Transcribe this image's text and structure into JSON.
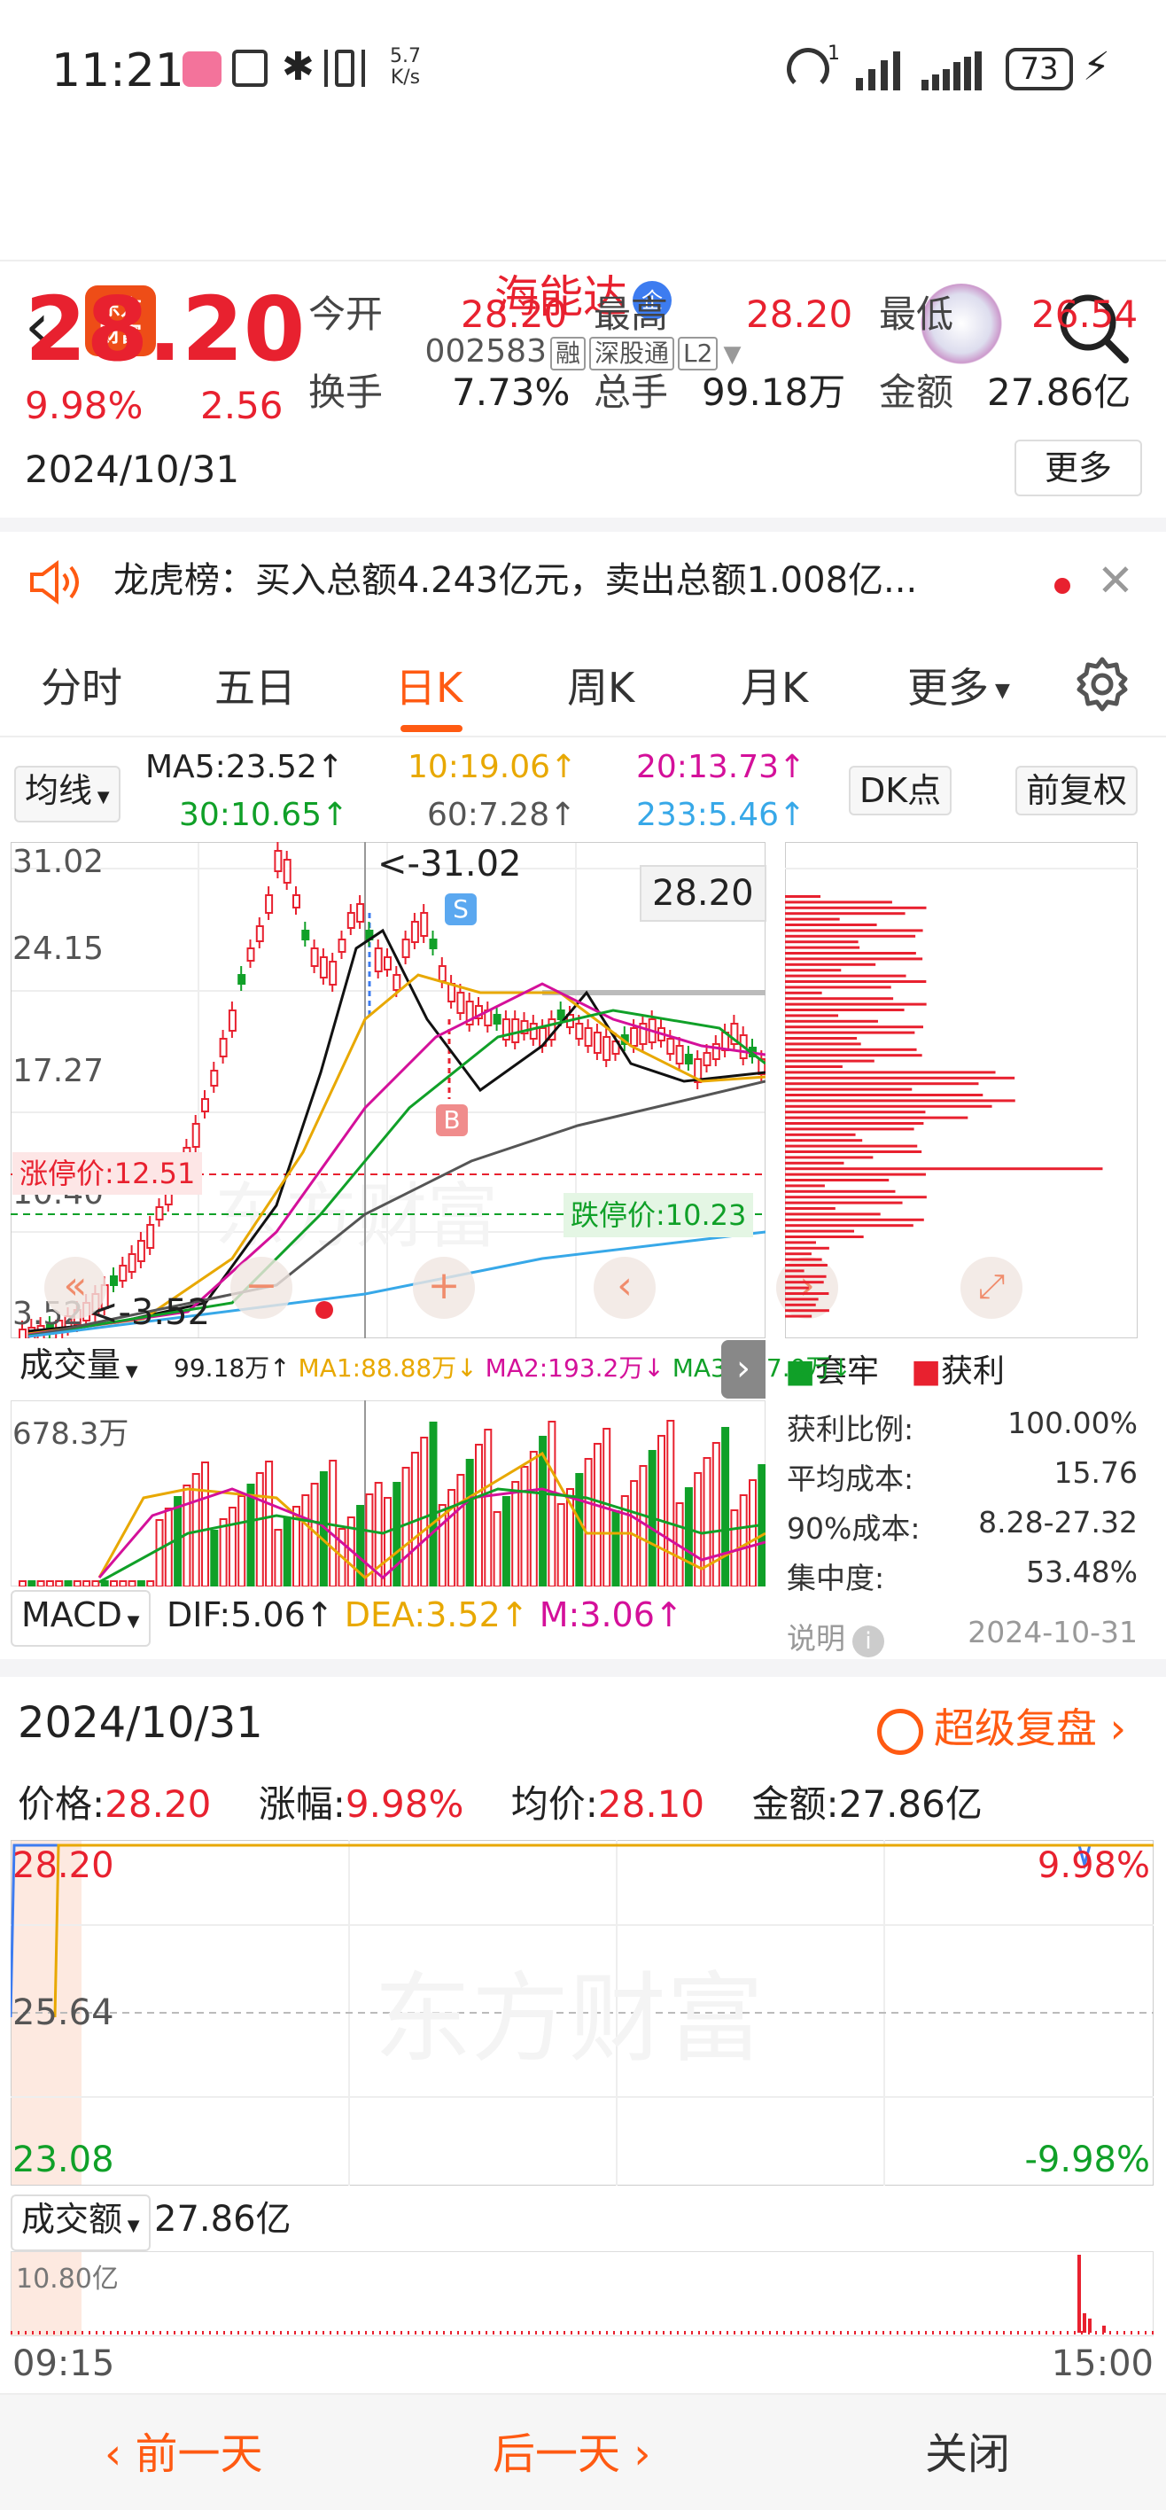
{
  "status_bar": {
    "time": "11:21",
    "speed_value": "5.7",
    "speed_unit": "K/s",
    "signal_sup": "1",
    "battery": "73"
  },
  "header": {
    "logo_text_1": "东方",
    "logo_text_2": "财富",
    "stock_name": "海能达",
    "badge": "企",
    "code": "002583",
    "tags": [
      "融",
      "深股通",
      "L2"
    ]
  },
  "quote": {
    "price": "28.20",
    "change_pct": "9.98%",
    "change": "2.56",
    "date": "2024/10/31",
    "stats": [
      {
        "label": "今开",
        "value": "28.20",
        "color": "red"
      },
      {
        "label": "最高",
        "value": "28.20",
        "color": "red"
      },
      {
        "label": "最低",
        "value": "26.54",
        "color": "red"
      },
      {
        "label": "换手",
        "value": "7.73%",
        "color": "dark"
      },
      {
        "label": "总手",
        "value": "99.18万",
        "color": "dark"
      },
      {
        "label": "金额",
        "value": "27.86亿",
        "color": "dark"
      }
    ],
    "more": "更多"
  },
  "notice": {
    "text": "龙虎榜：买入总额4.243亿元，卖出总额1.008亿..."
  },
  "tabs": [
    "分时",
    "五日",
    "日K",
    "周K",
    "月K",
    "更多"
  ],
  "active_tab": "日K",
  "kline": {
    "selector": "均线",
    "ma": [
      {
        "label": "MA5:23.52↑",
        "color": "#222"
      },
      {
        "label": "10:19.06↑",
        "color": "#e8a800"
      },
      {
        "label": "20:13.73↑",
        "color": "#d4109a"
      },
      {
        "label": "30:10.65↑",
        "color": "#10a028"
      },
      {
        "label": "60:7.28↑",
        "color": "#555"
      },
      {
        "label": "233:5.46↑",
        "color": "#37a8e8"
      }
    ],
    "dk": "DK点",
    "fq": "前复权",
    "y_labels": [
      "31.02",
      "24.15",
      "17.27",
      "10.40",
      "3.52"
    ],
    "high_mark": "<-31.02",
    "low_mark": "<-3.52",
    "last_price": "28.20",
    "limit_up": "涨停价:12.51",
    "limit_down": "跌停价:10.23",
    "s_mark": "S",
    "b_mark": "B"
  },
  "volume": {
    "selector": "成交量",
    "labels": [
      {
        "t": "99.18万↑",
        "c": "#222"
      },
      {
        "t": "MA1:88.88万↓",
        "c": "#e8a800"
      },
      {
        "t": "MA2:193.2万↓",
        "c": "#d4109a"
      },
      {
        "t": "MA3:277.0万↓",
        "c": "#10a028"
      }
    ],
    "max": "678.3万"
  },
  "macd": {
    "selector": "MACD",
    "dif": "DIF:5.06↑",
    "dea": "DEA:3.52↑",
    "m": "M:3.06↑"
  },
  "chip": {
    "legend": [
      "套牢",
      "获利"
    ],
    "rows": [
      {
        "k": "获利比例:",
        "v": "100.00%"
      },
      {
        "k": "平均成本:",
        "v": "15.76"
      },
      {
        "k": "90%成本:",
        "v": "8.28-27.32"
      },
      {
        "k": "集中度:",
        "v": "53.48%"
      }
    ],
    "note": "说明",
    "date": "2024-10-31"
  },
  "review": {
    "date": "2024/10/31",
    "link": "超级复盘",
    "price_lbl": "价格:",
    "price": "28.20",
    "chg_lbl": "涨幅:",
    "chg": "9.98%",
    "avg_lbl": "均价:",
    "avg": "28.10",
    "amt_lbl": "金额:",
    "amt": "27.86亿",
    "y_top": "28.20",
    "y_mid": "25.64",
    "y_bot": "23.08",
    "pct_top": "9.98%",
    "pct_bot": "-9.98%",
    "amt_selector": "成交额",
    "amt_value": "27.86亿",
    "amt_max": "10.80亿",
    "t_start": "09:15",
    "t_end": "15:00",
    "watermark": "东方财富"
  },
  "bottom": {
    "prev": "前一天",
    "next": "后一天",
    "close": "关闭"
  },
  "colors": {
    "up": "#e8212f",
    "down": "#10a028",
    "accent": "#ff5a12"
  }
}
